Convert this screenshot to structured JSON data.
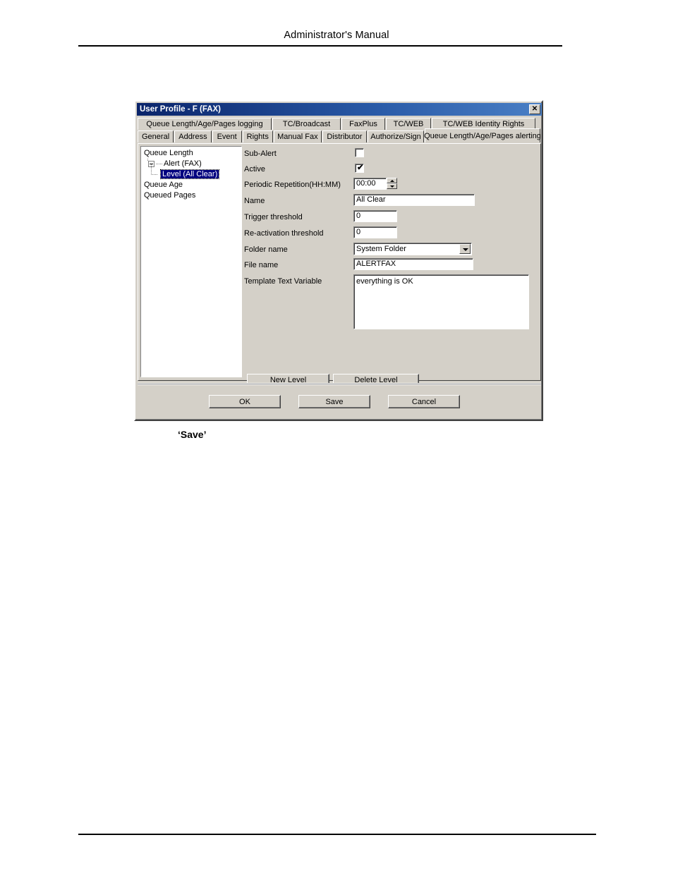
{
  "document": {
    "header_title": "Administrator's Manual",
    "figure_caption": "‘Save’"
  },
  "dialog": {
    "title": "User Profile - F (FAX)",
    "close_icon": "✕",
    "tabs_row1": [
      {
        "label": "Queue Length/Age/Pages logging",
        "selected": false
      },
      {
        "label": "TC/Broadcast",
        "selected": false
      },
      {
        "label": "FaxPlus",
        "selected": false
      },
      {
        "label": "TC/WEB",
        "selected": false
      },
      {
        "label": "TC/WEB Identity Rights",
        "selected": false
      }
    ],
    "tabs_row2": [
      {
        "label": "General",
        "selected": false
      },
      {
        "label": "Address",
        "selected": false
      },
      {
        "label": "Event",
        "selected": false
      },
      {
        "label": "Rights",
        "selected": false
      },
      {
        "label": "Manual Fax",
        "selected": false
      },
      {
        "label": "Distributor",
        "selected": false
      },
      {
        "label": "Authorize/Sign",
        "selected": false
      },
      {
        "label": "Queue Length/Age/Pages alerting",
        "selected": true
      }
    ],
    "tree": {
      "node_queue_length": "Queue Length",
      "node_alert_fax": "Alert (FAX)",
      "node_level_all_clear": "Level (All Clear)",
      "node_queue_age": "Queue Age",
      "node_queued_pages": "Queued Pages"
    },
    "form": {
      "sub_alert_label": "Sub-Alert",
      "sub_alert_checked": "",
      "active_label": "Active",
      "active_checked": "✔",
      "periodic_repetition_label": "Periodic Repetition(HH:MM)",
      "periodic_repetition_value": "00:00",
      "name_label": "Name",
      "name_value": "All Clear",
      "trigger_threshold_label": "Trigger threshold",
      "trigger_threshold_value": "0",
      "reactivation_threshold_label": "Re-activation threshold",
      "reactivation_threshold_value": "0",
      "folder_name_label": "Folder name",
      "folder_name_value": "System Folder",
      "file_name_label": "File name",
      "file_name_value": "ALERTFAX",
      "template_text_label": "Template Text Variable",
      "template_text_value": "everything is OK"
    },
    "level_buttons": {
      "new_level_accel": "N",
      "new_level_rest": "ew Level",
      "delete_level_accel": "D",
      "delete_level_rest": "elete Level"
    },
    "footer_buttons": {
      "ok": "OK",
      "save": "Save",
      "cancel": "Cancel"
    }
  }
}
